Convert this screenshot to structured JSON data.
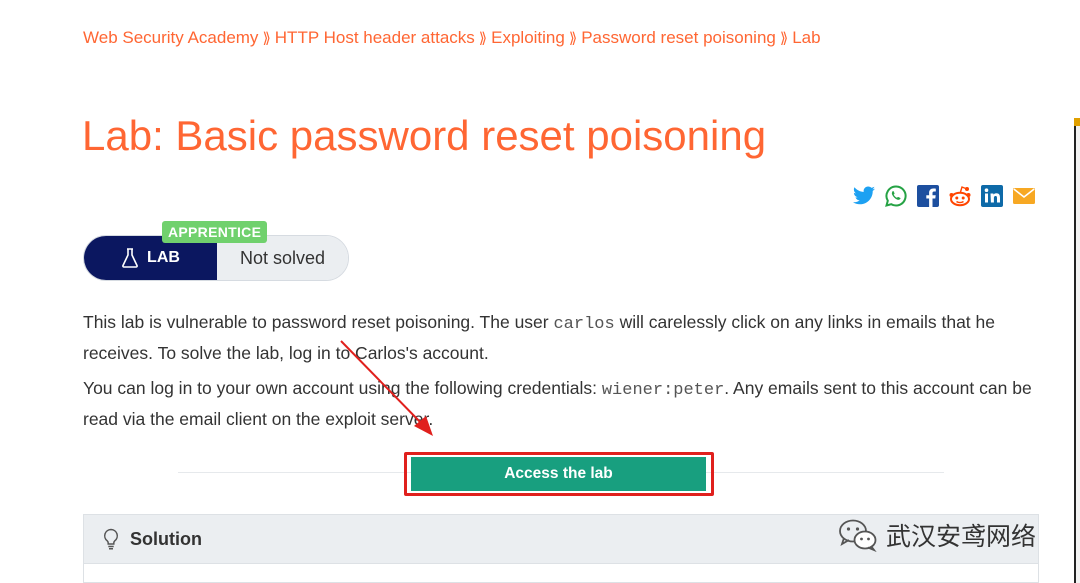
{
  "breadcrumb": {
    "items": [
      "Web Security Academy",
      "HTTP Host header attacks",
      "Exploiting",
      "Password reset poisoning",
      "Lab"
    ],
    "separator": "⟫"
  },
  "title": "Lab: Basic password reset poisoning",
  "share_icons": [
    "twitter-icon",
    "whatsapp-icon",
    "facebook-icon",
    "reddit-icon",
    "linkedin-icon",
    "email-icon"
  ],
  "badge": {
    "level": "APPRENTICE",
    "type_label": "LAB",
    "status": "Not solved"
  },
  "description": {
    "p1_before": "This lab is vulnerable to password reset poisoning. The user ",
    "p1_code": "carlos",
    "p1_after": " will carelessly click on any links in emails that he receives. To solve the lab, log in to Carlos's account.",
    "p2_before": "You can log in to your own account using the following credentials: ",
    "p2_code": "wiener:peter",
    "p2_after": ". Any emails sent to this account can be read via the email client on the exploit server."
  },
  "access_button": "Access the lab",
  "solution_label": "Solution",
  "watermark_text": "武汉安鸢网络",
  "colors": {
    "accent": "#ff6633",
    "lab_badge": "#0b1760",
    "apprentice": "#70d16d",
    "access_button": "#189f7f",
    "highlight": "#e0201d"
  }
}
